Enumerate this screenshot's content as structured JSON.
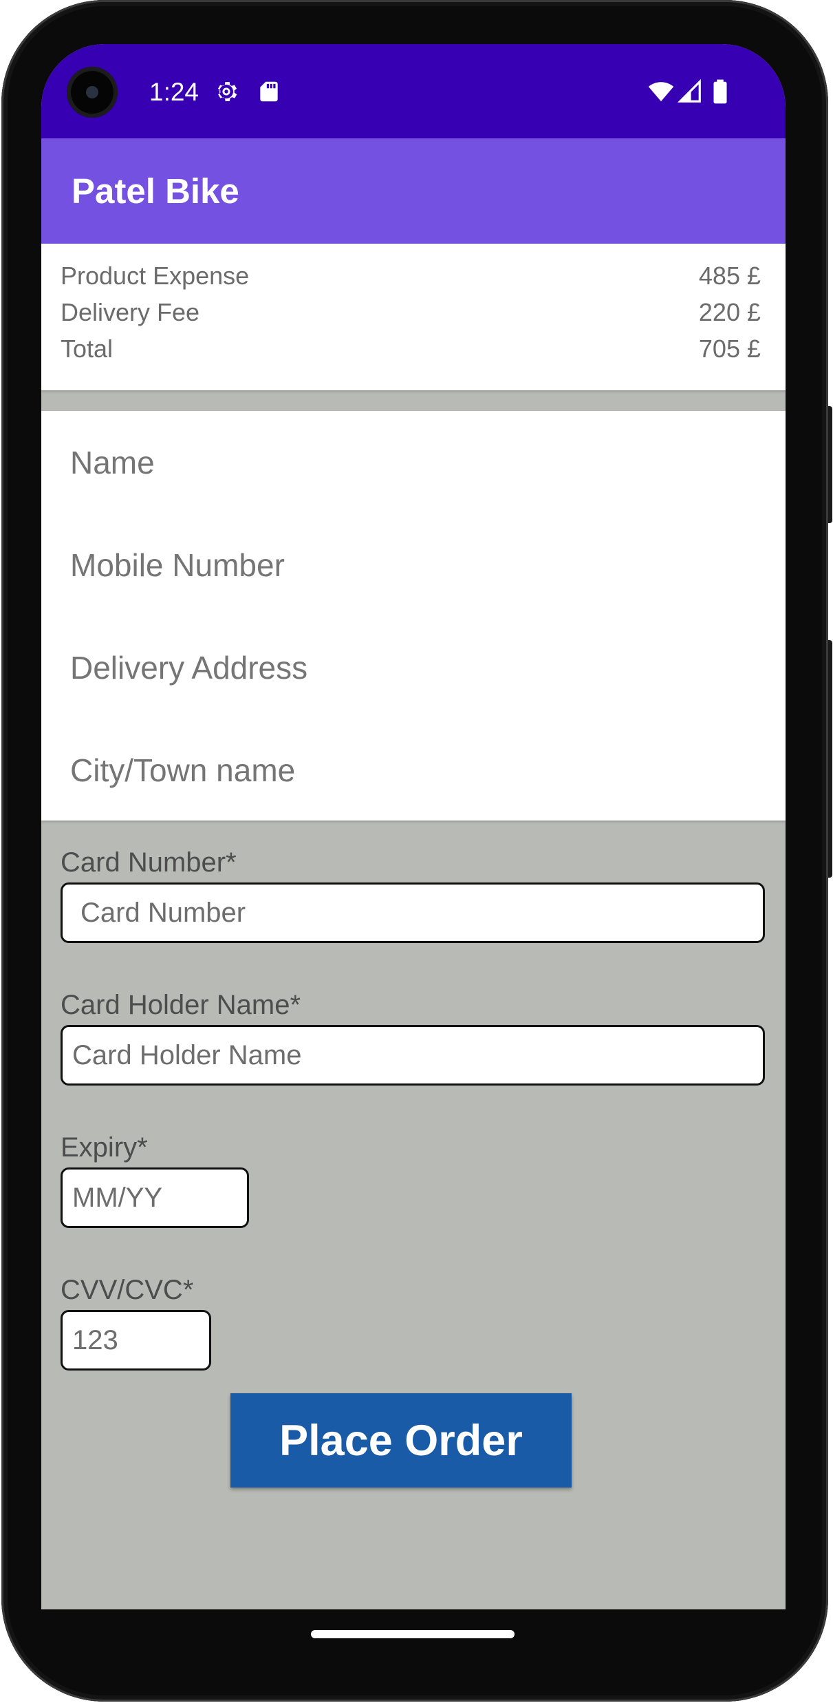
{
  "status_bar": {
    "time": "1:24",
    "icons": [
      "settings-gear-icon",
      "sd-card-icon",
      "wifi-icon",
      "cell-signal-icon",
      "battery-icon"
    ],
    "background": "#3700b3"
  },
  "app_bar": {
    "title": "Patel Bike",
    "background": "#7551e1"
  },
  "order_summary": {
    "rows": [
      {
        "label": "Product Expense",
        "value": "485 £"
      },
      {
        "label": "Delivery Fee",
        "value": "220 £"
      },
      {
        "label": "Total",
        "value": "705 £"
      }
    ]
  },
  "contact_form": {
    "name_placeholder": "Name",
    "mobile_placeholder": "Mobile Number",
    "address_placeholder": "Delivery Address",
    "city_placeholder": "City/Town name"
  },
  "payment_form": {
    "card_number": {
      "label": "Card Number*",
      "placeholder": "Card Number",
      "value": ""
    },
    "card_holder": {
      "label": "Card Holder Name*",
      "placeholder": "Card Holder Name",
      "value": ""
    },
    "expiry": {
      "label": "Expiry*",
      "placeholder": "MM/YY",
      "value": ""
    },
    "cvv": {
      "label": "CVV/CVC*",
      "placeholder": "123",
      "value": ""
    }
  },
  "actions": {
    "place_order_label": "Place Order",
    "place_order_color": "#1a5ba8"
  },
  "colors": {
    "screen_background": "#b8bab6"
  }
}
